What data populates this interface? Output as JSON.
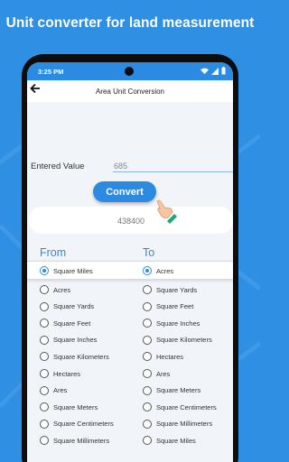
{
  "promo_title": "Unit converter for land measurement",
  "status_bar": {
    "time": "3:25 PM"
  },
  "app_bar": {
    "title": "Area Unit Conversion"
  },
  "form": {
    "entered_value_label": "Entered Value",
    "entered_value": "685",
    "convert_label": "Convert",
    "result": "438400"
  },
  "from": {
    "heading": "From",
    "selected": "Square Miles",
    "options": [
      "Acres",
      "Square Yards",
      "Square Feet",
      "Square Inches",
      "Square Kilometers",
      "Hectares",
      "Ares",
      "Square Meters",
      "Square Centimeters",
      "Square Millimeters"
    ]
  },
  "to": {
    "heading": "To",
    "selected": "Acres",
    "options": [
      "Square Yards",
      "Square Feet",
      "Square Inches",
      "Square Kilometers",
      "Hectares",
      "Ares",
      "Square Meters",
      "Square Centimeters",
      "Square Millimeters",
      "Square Miles"
    ]
  },
  "colors": {
    "accent": "#2b8be3",
    "background": "#2f8fe3",
    "panel": "#f1f4f8"
  },
  "icons": [
    "back-arrow-icon",
    "wifi-icon",
    "signal-icon",
    "battery-icon",
    "pointing-hand-icon"
  ]
}
